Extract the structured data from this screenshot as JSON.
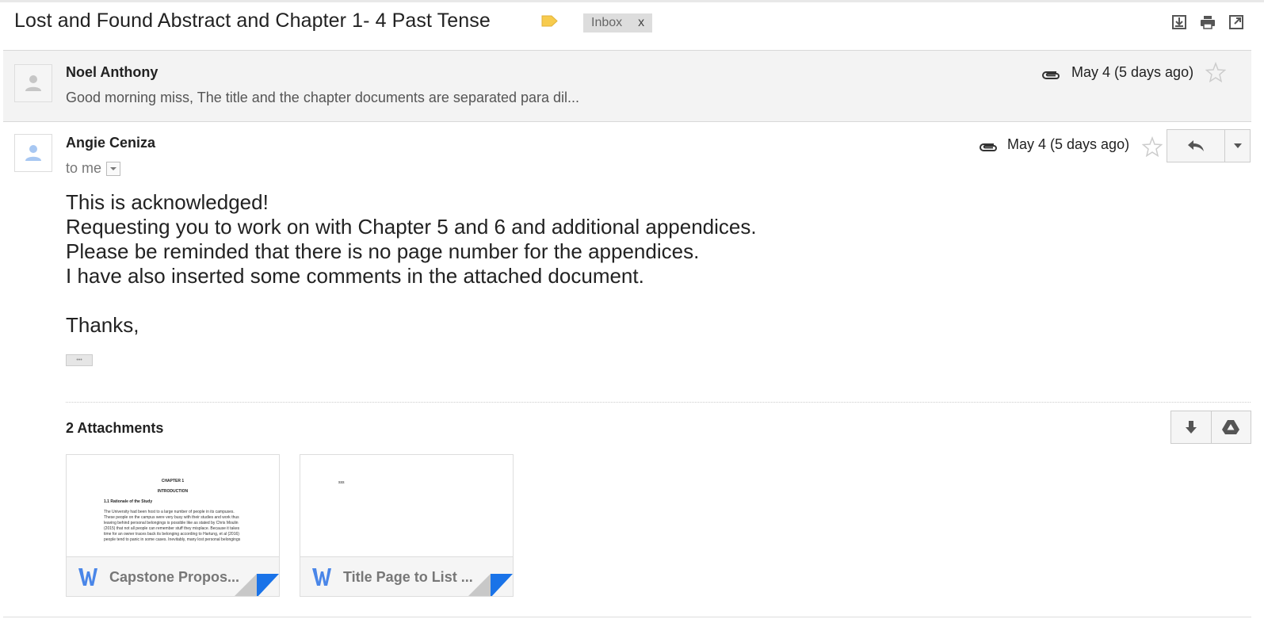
{
  "thread": {
    "subject": "Lost and Found Abstract and Chapter 1- 4 Past Tense",
    "label_color": "#f7cb4d",
    "inbox_chip": {
      "label": "Inbox",
      "remove": "x"
    },
    "header_icons": [
      "download-icon",
      "print-icon",
      "open-in-new-window-icon"
    ]
  },
  "collapsed_message": {
    "sender": "Noel Anthony",
    "snippet": "Good morning miss, The title and the chapter documents are separated para dil...",
    "date": "May 4 (5 days ago)"
  },
  "expanded_message": {
    "sender": "Angie Ceniza",
    "recipient": "to me",
    "date": "May 4 (5 days ago)",
    "body_lines": [
      "This is acknowledged!",
      "Requesting you to work on with Chapter 5 and 6 and additional appendices.",
      "Please be reminded that there is no page number for the appendices.",
      "I have also inserted some comments in the attached document.",
      "",
      "Thanks,"
    ],
    "ellipsis": "•••"
  },
  "attachments": {
    "title": "2 Attachments",
    "items": [
      {
        "name": "Capstone Propos...",
        "preview": {
          "heading": "CHAPTER 1",
          "subheading": "INTRODUCTION",
          "section": "1.1 Rationale of the Study",
          "lines": [
            "The University had been host to a large number of people in its campuses.",
            "These people on the campus were very busy with their studies and work thus",
            "leaving behind personal belongings is possible like as stated by Chris Moulin",
            "(2015) that not all people can remember stuff they misplace. Because it takes",
            "time for an owner traces back its belonging according to Hartung, et al (2016)",
            "people tend to panic in some cases. Inevitably, many lost personal belongings"
          ]
        }
      },
      {
        "name": "Title Page to List ...",
        "preview": {
          "text": "sss"
        }
      }
    ]
  },
  "colors": {
    "word_blue": "#4a86e8",
    "corner_blue": "#1a73e8",
    "collapsed_bg": "#f3f3f3"
  }
}
